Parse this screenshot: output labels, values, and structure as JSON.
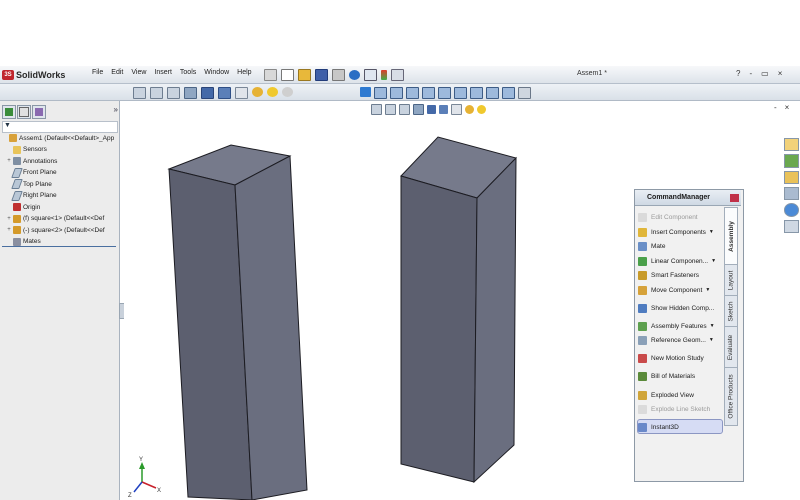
{
  "app": {
    "name": "SolidWorks",
    "document_title": "Assem1 *"
  },
  "menu": [
    "File",
    "Edit",
    "View",
    "Insert",
    "Tools",
    "Window",
    "Help"
  ],
  "window_controls": [
    "?",
    "-",
    "▭",
    "×"
  ],
  "viewport_controls": [
    "-",
    "▭",
    "×"
  ],
  "tree": [
    {
      "label": "Assem1  (Default<<Default>_App",
      "level": 0,
      "expander": "",
      "icon": "assembly-icon"
    },
    {
      "label": "Sensors",
      "level": 1,
      "expander": "",
      "icon": "sensor-icon"
    },
    {
      "label": "Annotations",
      "level": 1,
      "expander": "+",
      "icon": "annotation-icon"
    },
    {
      "label": "Front Plane",
      "level": 1,
      "expander": "",
      "icon": "plane-icon"
    },
    {
      "label": "Top Plane",
      "level": 1,
      "expander": "",
      "icon": "plane-icon"
    },
    {
      "label": "Right Plane",
      "level": 1,
      "expander": "",
      "icon": "plane-icon"
    },
    {
      "label": "Origin",
      "level": 1,
      "expander": "",
      "icon": "origin-icon"
    },
    {
      "label": "(f) square<1> (Default<<Def",
      "level": 1,
      "expander": "+",
      "icon": "part-icon"
    },
    {
      "label": "(-) square<2> (Default<<Def",
      "level": 1,
      "expander": "+",
      "icon": "part-icon"
    },
    {
      "label": "Mates",
      "level": 1,
      "expander": "",
      "icon": "mates-icon"
    }
  ],
  "command_manager": {
    "title": "CommandManager",
    "items": [
      {
        "label": "Edit Component",
        "disabled": true,
        "dropdown": false
      },
      {
        "label": "Insert Components",
        "disabled": false,
        "dropdown": true
      },
      {
        "label": "Mate",
        "disabled": false,
        "dropdown": false
      },
      {
        "label": "Linear Componen...",
        "disabled": false,
        "dropdown": true
      },
      {
        "label": "Smart Fasteners",
        "disabled": false,
        "dropdown": false
      },
      {
        "label": "Move Component",
        "disabled": false,
        "dropdown": true
      },
      {
        "label": "Show Hidden Comp...",
        "disabled": false,
        "dropdown": false
      },
      {
        "label": "Assembly Features",
        "disabled": false,
        "dropdown": true
      },
      {
        "label": "Reference Geom...",
        "disabled": false,
        "dropdown": true
      },
      {
        "label": "New Motion Study",
        "disabled": false,
        "dropdown": false
      },
      {
        "label": "Bill of Materials",
        "disabled": false,
        "dropdown": false
      },
      {
        "label": "Exploded View",
        "disabled": false,
        "dropdown": false
      },
      {
        "label": "Explode Line Sketch",
        "disabled": true,
        "dropdown": false
      },
      {
        "label": "Instant3D",
        "disabled": false,
        "dropdown": false,
        "active": true
      }
    ],
    "tabs": [
      "Assembly",
      "Layout",
      "Sketch",
      "Evaluate",
      "Office Products"
    ],
    "active_tab": "Assembly"
  },
  "colors": {
    "block_front": "#5c5f6f",
    "block_side": "#6c7081",
    "block_top": "#767a8b",
    "edge": "#1c1c22"
  }
}
